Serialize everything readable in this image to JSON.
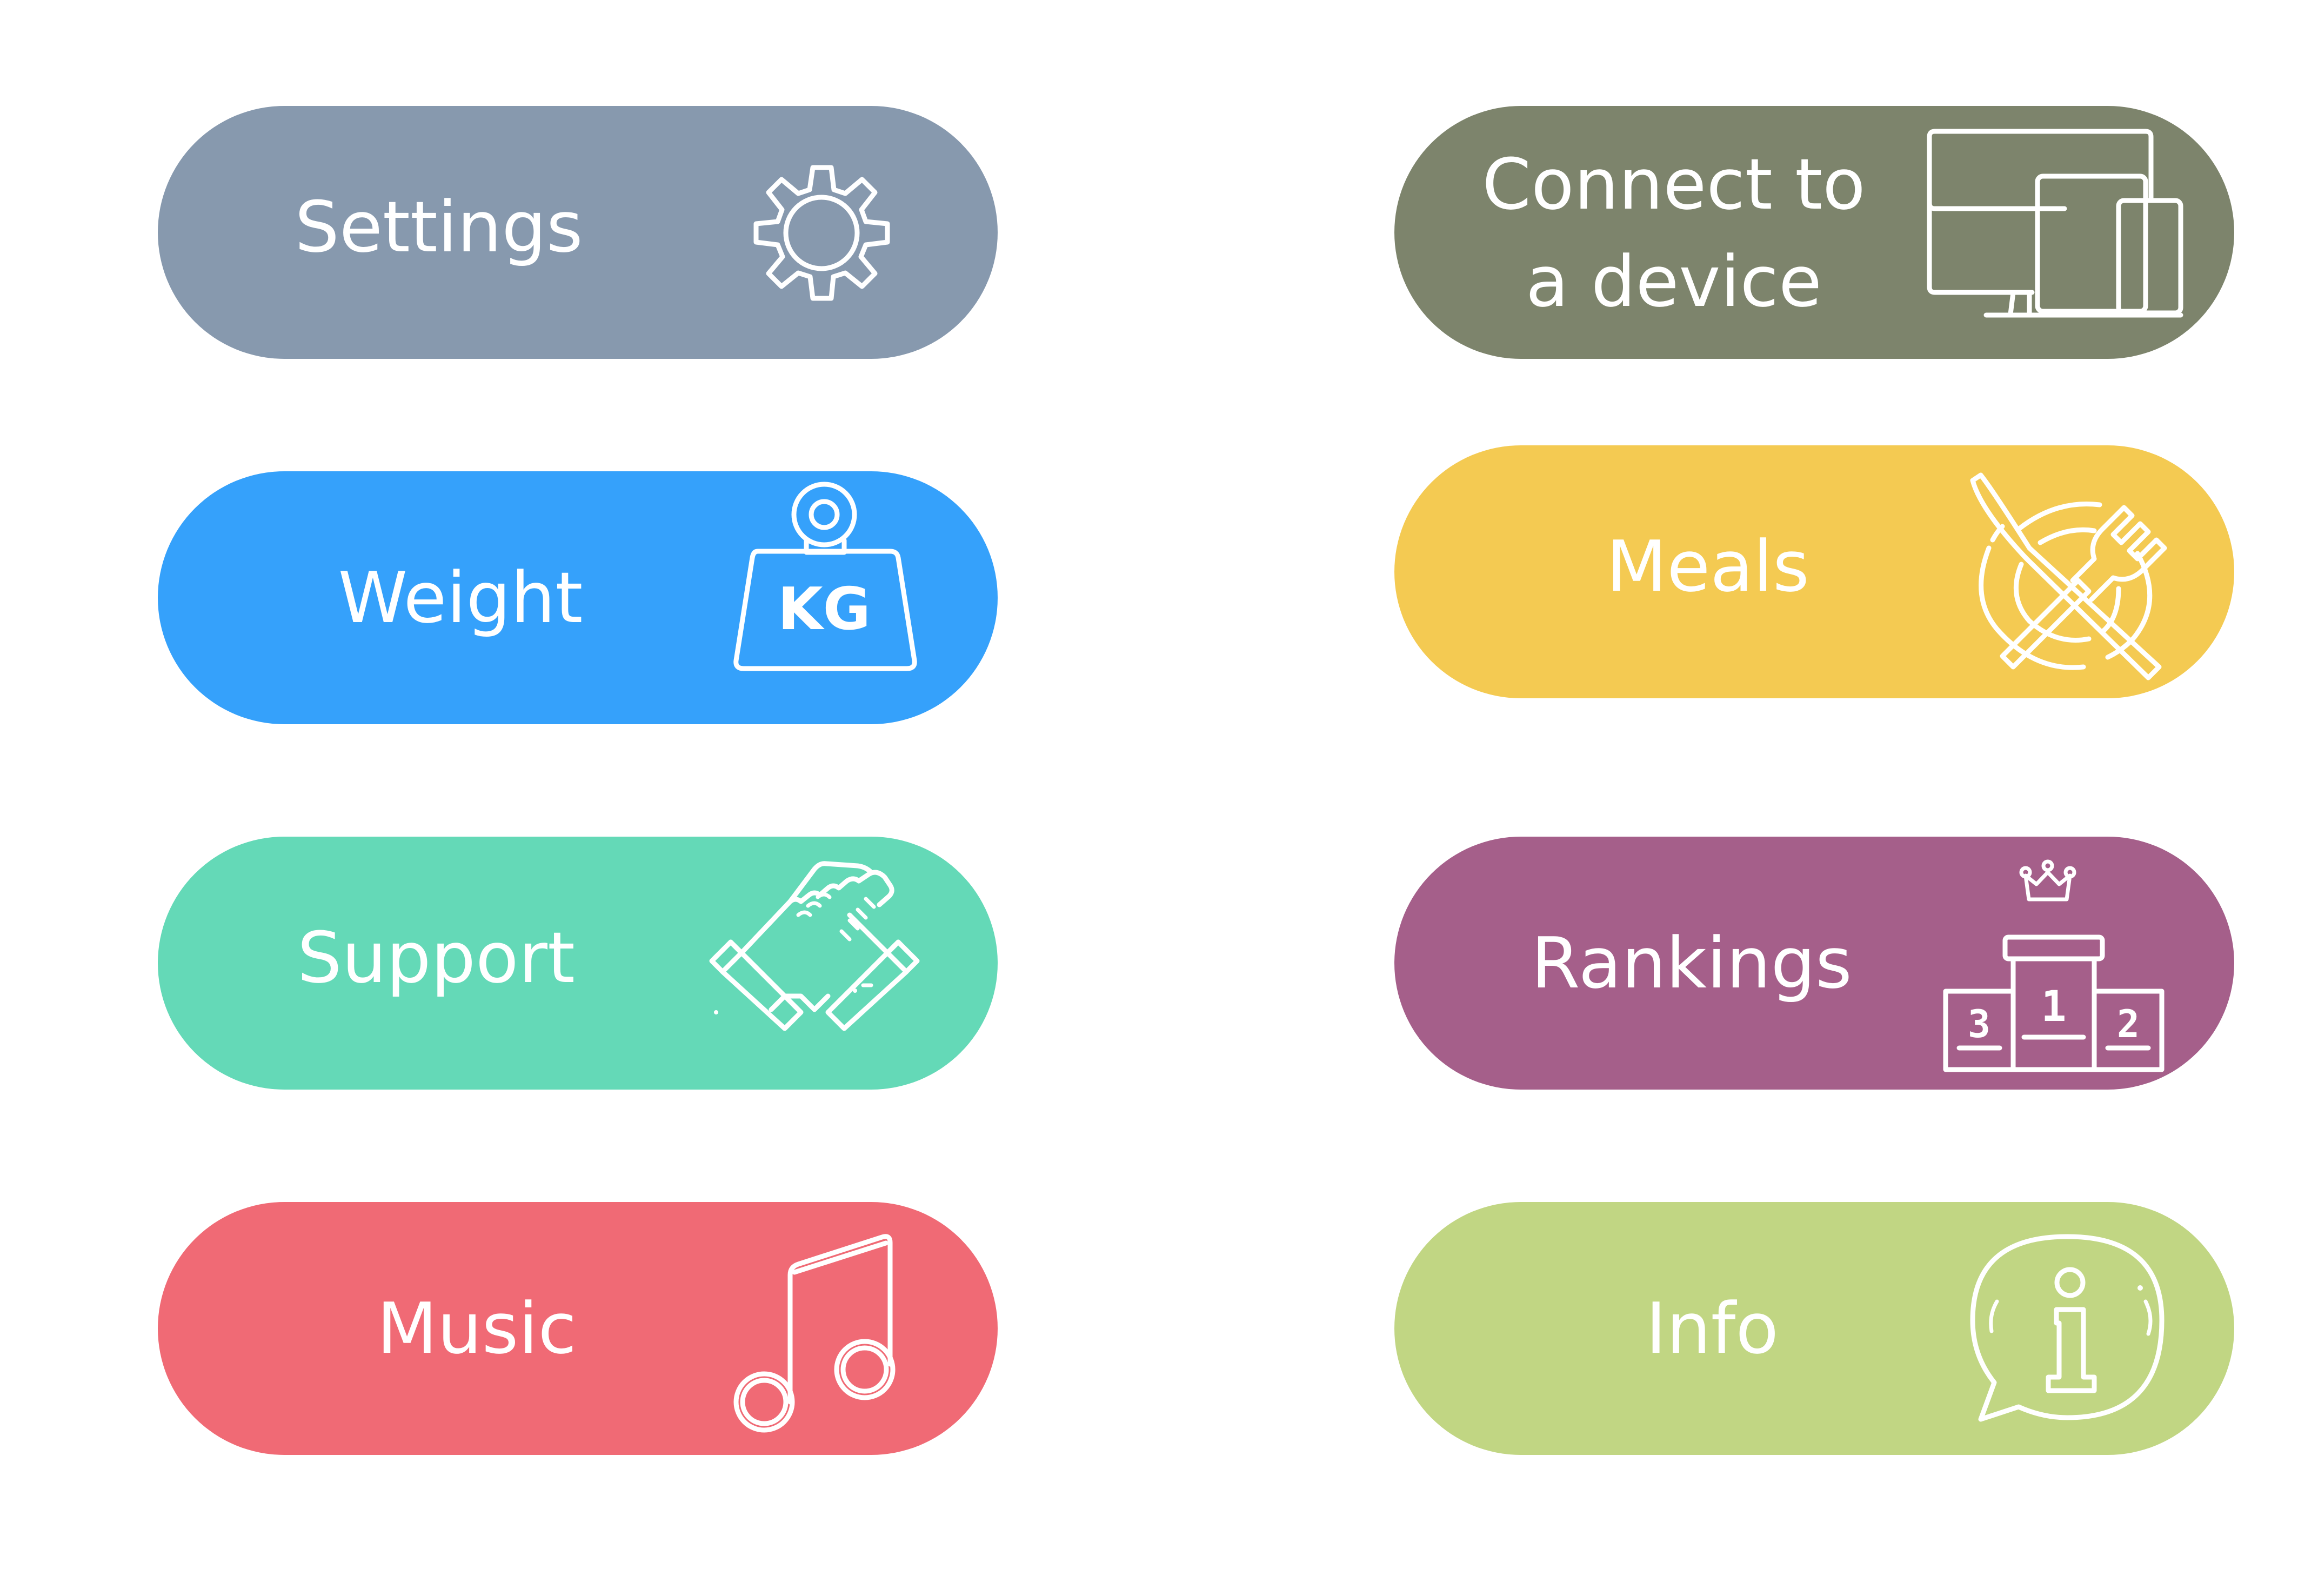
{
  "buttons": {
    "settings": {
      "label": "Settings",
      "color": "#8799ae",
      "icon": "gear-icon"
    },
    "weight": {
      "label": "Weight",
      "color": "#35a1fb",
      "icon": "kg-weight-icon"
    },
    "support": {
      "label": "Support",
      "color": "#64d9b7",
      "icon": "handshake-icon"
    },
    "music": {
      "label": "Music",
      "color": "#f06a75",
      "icon": "music-note-icon"
    },
    "connect": {
      "line1": "Connect to",
      "line2": "a device",
      "color": "#7d846c",
      "icon": "devices-icon"
    },
    "meals": {
      "label": "Meals",
      "color": "#f4ca52",
      "icon": "plate-cutlery-icon"
    },
    "rankings": {
      "label": "Rankings",
      "color": "#a55f8a",
      "icon": "podium-icon"
    },
    "info": {
      "label": "Info",
      "color": "#c1d683",
      "icon": "info-chat-icon"
    }
  },
  "icon_text": {
    "kg": "KG",
    "podium_first": "1",
    "podium_second": "2",
    "podium_third": "3"
  }
}
